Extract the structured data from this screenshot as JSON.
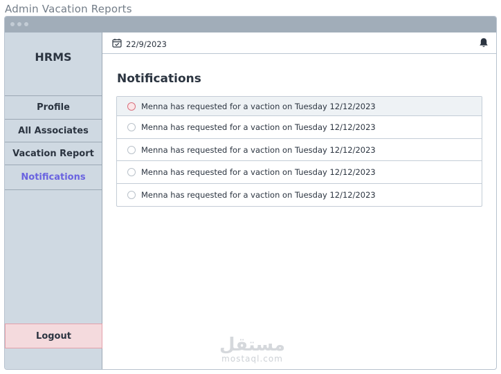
{
  "page": {
    "title": "Admin Vacation Reports"
  },
  "sidebar": {
    "brand": "HRMS",
    "items": [
      {
        "label": "Profile",
        "active": false
      },
      {
        "label": "All Associates",
        "active": false
      },
      {
        "label": "Vacation Report",
        "active": false
      },
      {
        "label": "Notifications",
        "active": true
      }
    ],
    "logout_label": "Logout"
  },
  "topbar": {
    "date": "22/9/2023",
    "calendar_icon": "calendar-check-icon",
    "bell_icon": "bell-icon"
  },
  "main": {
    "heading": "Notifications",
    "notifications": [
      {
        "text": "Menna has requested for a vaction on Tuesday 12/12/2023",
        "unread": true
      },
      {
        "text": "Menna has requested for a vaction on Tuesday 12/12/2023",
        "unread": false
      },
      {
        "text": "Menna has requested for a vaction on Tuesday 12/12/2023",
        "unread": false
      },
      {
        "text": "Menna has requested for a vaction on Tuesday 12/12/2023",
        "unread": false
      },
      {
        "text": "Menna has requested for a vaction on Tuesday 12/12/2023",
        "unread": false
      }
    ]
  },
  "watermark": {
    "arabic": "مستقل",
    "latin": "mostaql.com"
  },
  "colors": {
    "sidebar_bg": "#cfd9e2",
    "active_nav": "#6a63e0",
    "logout_bg": "#f4dadd",
    "unread_dot": "#d9707d",
    "titlebar": "#a1adb9"
  }
}
